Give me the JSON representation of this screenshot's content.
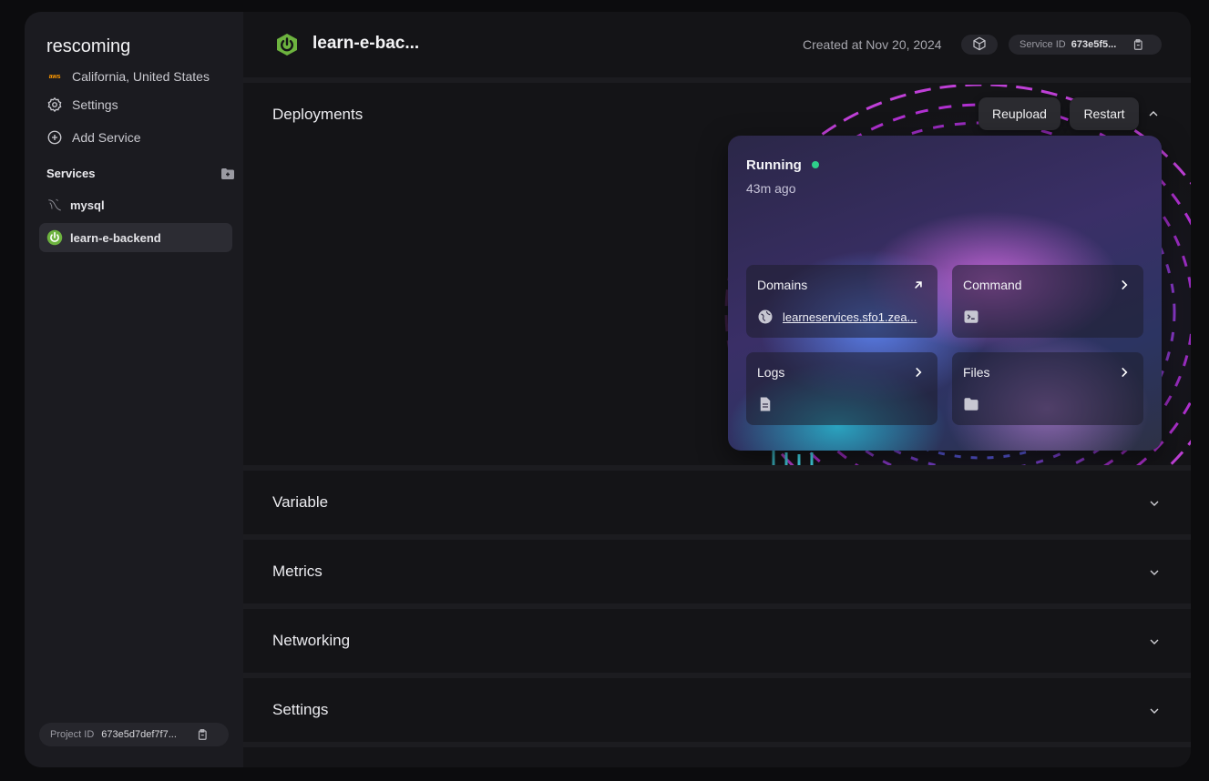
{
  "sidebar": {
    "project_name": "rescoming",
    "region": "California, United States",
    "region_provider_icon": "aws-icon",
    "settings_label": "Settings",
    "add_service_label": "Add Service",
    "services_heading": "Services",
    "services": [
      {
        "label": "mysql",
        "icon": "mysql-icon",
        "active": false
      },
      {
        "label": "learn-e-backend",
        "icon": "spring-icon",
        "active": true
      }
    ],
    "project_id_label": "Project ID",
    "project_id_value": "673e5d7def7f7..."
  },
  "header": {
    "title": "learn-e-bac...",
    "created": "Created at Nov 20, 2024",
    "service_id_label": "Service ID",
    "service_id_value": "673e5f5..."
  },
  "deployments": {
    "title": "Deployments",
    "reupload_label": "Reupload",
    "restart_label": "Restart",
    "status": "Running",
    "status_color": "#2ecf8a",
    "time_ago": "43m ago",
    "tiles": {
      "domains": {
        "title": "Domains",
        "link": "learneservices.sfo1.zea..."
      },
      "command": {
        "title": "Command"
      },
      "logs": {
        "title": "Logs"
      },
      "files": {
        "title": "Files"
      }
    }
  },
  "sections": {
    "variable": "Variable",
    "metrics": "Metrics",
    "networking": "Networking",
    "settings": "Settings"
  },
  "colors": {
    "background": "#0c0c0e",
    "panel": "#141417",
    "sidebar": "#1b1b20",
    "accent_green": "#6db33f"
  }
}
